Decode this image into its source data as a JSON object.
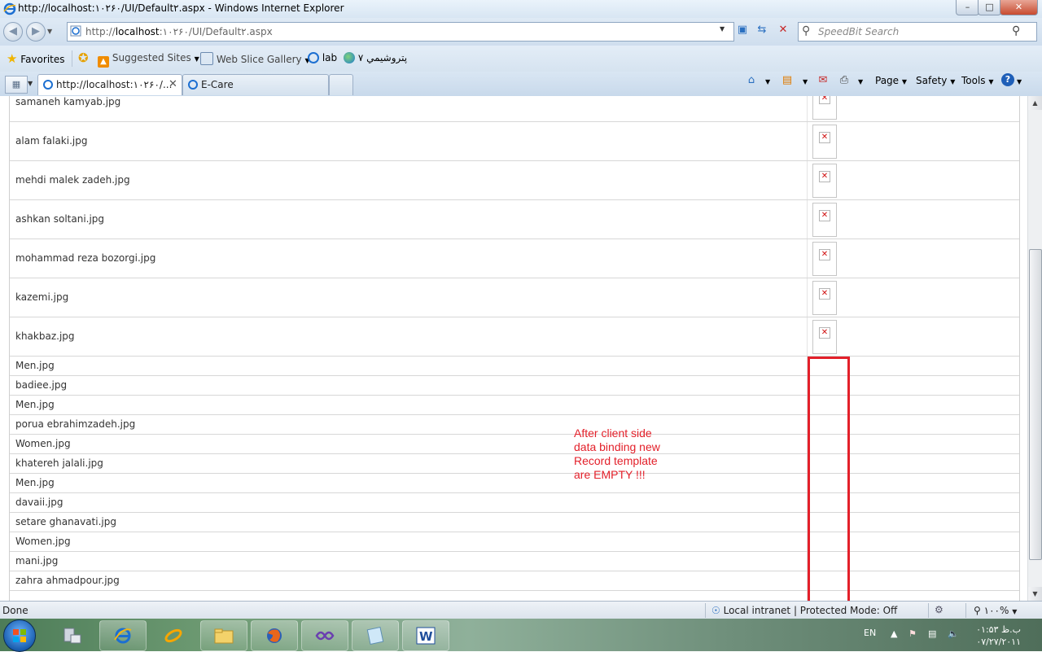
{
  "window": {
    "title": "http://localhost:۱۰۲۶۰/UI/Default۲.aspx - Windows Internet Explorer",
    "minimize": "–",
    "maximize": "□",
    "close": "✕"
  },
  "address_bar": {
    "url_prefix": "http://",
    "url_host": "localhost",
    "url_rest": ":۱۰۲۶۰/UI/Default۲.aspx",
    "search_placeholder": "SpeedBit Search"
  },
  "favorites_bar": {
    "favorites_label": "Favorites",
    "items": [
      "Suggested Sites",
      "Web Slice Gallery",
      "lab",
      "پتروشيمي ۷"
    ]
  },
  "tabs": [
    {
      "label": "http://localhost:۱۰۲۶۰/...",
      "active": true
    },
    {
      "label": "E-Care",
      "active": false
    }
  ],
  "command_bar": {
    "page": "Page",
    "safety": "Safety",
    "tools": "Tools"
  },
  "records_with_image": [
    "samaneh kamyab.jpg",
    "alam falaki.jpg",
    "mehdi malek zadeh.jpg",
    "ashkan soltani.jpg",
    "mohammad reza bozorgi.jpg",
    "kazemi.jpg",
    "khakbaz.jpg"
  ],
  "records_empty": [
    "Men.jpg",
    "badiee.jpg",
    "Men.jpg",
    "porua ebrahimzadeh.jpg",
    "Women.jpg",
    "khatereh jalali.jpg",
    "Men.jpg",
    "davaii.jpg",
    "setare ghanavati.jpg",
    "Women.jpg",
    "mani.jpg",
    "zahra ahmadpour.jpg"
  ],
  "broken_image_glyph": "✕",
  "annotation": {
    "text": "After client side\ndata binding new\nRecord template\nare EMPTY !!!",
    "color": "#e3202a"
  },
  "status_bar": {
    "status": "Done",
    "zone": "Local intranet | Protected Mode: Off",
    "zoom": "۱۰۰%"
  },
  "taskbar": {
    "language": "EN",
    "time": "۰۱:۵۳ ب.ظ",
    "date": "۰۷/۲۷/۲۰۱۱"
  }
}
